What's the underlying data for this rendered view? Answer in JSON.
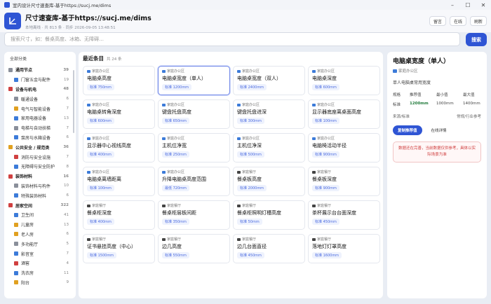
{
  "window": {
    "title": "室内设计尺寸速查库-基于https://sucj.me/dims"
  },
  "header": {
    "title": "尺寸速查库-基于https://sucj.me/dims",
    "subtitle": "本地离线 · 共 813 条 · 同步 2026-09-05 13:48:51",
    "buttons": [
      "留言",
      "在线",
      "刷新"
    ]
  },
  "search": {
    "placeholder": "搜索尺寸，如：餐桌高度、冰箱、无障碍…",
    "button": "搜索"
  },
  "sidebar": {
    "header": "全部分类",
    "items": [
      {
        "label": "通用节点",
        "count": "39",
        "level": "section",
        "color": "#8a8f9a"
      },
      {
        "label": "门窗五金与配件",
        "count": "19",
        "level": "sub",
        "color": "#3c7bd9"
      },
      {
        "label": "设备与机电",
        "count": "48",
        "level": "section",
        "color": "#d04040"
      },
      {
        "label": "暖通设备",
        "count": "6",
        "level": "sub",
        "color": "#8a8f9a"
      },
      {
        "label": "电气与智能设备",
        "count": "7",
        "level": "sub",
        "color": "#e0a020"
      },
      {
        "label": "家用电器设备",
        "count": "13",
        "level": "sub",
        "color": "#3c7bd9"
      },
      {
        "label": "电梯与自动扶梯",
        "count": "7",
        "level": "sub",
        "color": "#8a8f9a"
      },
      {
        "label": "泵房与水箱设备",
        "count": "6",
        "level": "sub",
        "color": "#3c7bd9"
      },
      {
        "label": "公共安全 / 规范类",
        "count": "36",
        "level": "section",
        "color": "#e0a020"
      },
      {
        "label": "消防与安全设施",
        "count": "7",
        "level": "sub",
        "color": "#d04040"
      },
      {
        "label": "无障碍与安全防护",
        "count": "8",
        "level": "sub",
        "color": "#3c7bd9"
      },
      {
        "label": "装饰材料",
        "count": "16",
        "level": "section",
        "color": "#d04040"
      },
      {
        "label": "装饰材料与构件",
        "count": "10",
        "level": "sub",
        "color": "#8a8f9a"
      },
      {
        "label": "特殊装饰材料",
        "count": "6",
        "level": "sub",
        "color": "#3c7bd9"
      },
      {
        "label": "居家空间",
        "count": "322",
        "level": "section",
        "color": "#d04040"
      },
      {
        "label": "卫生间",
        "count": "41",
        "level": "sub",
        "color": "#3c7bd9"
      },
      {
        "label": "儿童房",
        "count": "13",
        "level": "sub",
        "color": "#e0a020"
      },
      {
        "label": "老人房",
        "count": "6",
        "level": "sub",
        "color": "#e0a020"
      },
      {
        "label": "多功能厅",
        "count": "5",
        "level": "sub",
        "color": "#8a8f9a"
      },
      {
        "label": "影音室",
        "count": "7",
        "level": "sub",
        "color": "#3c7bd9"
      },
      {
        "label": "酒窖",
        "count": "4",
        "level": "sub",
        "color": "#d04040"
      },
      {
        "label": "洗衣房",
        "count": "11",
        "level": "sub",
        "color": "#3c7bd9"
      },
      {
        "label": "阳台",
        "count": "9",
        "level": "sub",
        "color": "#e0a020"
      }
    ]
  },
  "main": {
    "title": "最近条目",
    "count": "共 24 条",
    "cards": [
      {
        "category": "家庭办公区",
        "name": "电脑桌高度",
        "tag": "标准 750mm",
        "color": "#3c7bd9"
      },
      {
        "category": "家庭办公区",
        "name": "电脑桌宽度（单人）",
        "tag": "标准 1200mm",
        "color": "#3c7bd9",
        "selected": true
      },
      {
        "category": "家庭办公区",
        "name": "电脑桌宽度（双人）",
        "tag": "标准 2400mm",
        "color": "#3c7bd9"
      },
      {
        "category": "家庭办公区",
        "name": "电脑桌深度",
        "tag": "标准 600mm",
        "color": "#3c7bd9"
      },
      {
        "category": "家庭办公区",
        "name": "电脑桌转角深度",
        "tag": "标准 600mm",
        "color": "#3c7bd9"
      },
      {
        "category": "家庭办公区",
        "name": "键盘托盘高度",
        "tag": "标准 650mm",
        "color": "#3c7bd9"
      },
      {
        "category": "家庭办公区",
        "name": "键盘托盘进深",
        "tag": "标准 300mm",
        "color": "#3c7bd9"
      },
      {
        "category": "家庭办公区",
        "name": "显示器底座离桌面高度",
        "tag": "标准 100mm",
        "color": "#3c7bd9"
      },
      {
        "category": "家庭办公区",
        "name": "显示器中心视线高度",
        "tag": "标准 400mm",
        "color": "#3c7bd9"
      },
      {
        "category": "家庭办公区",
        "name": "主机位净宽",
        "tag": "标准 250mm",
        "color": "#3c7bd9"
      },
      {
        "category": "家庭办公区",
        "name": "主机位净深",
        "tag": "标准 500mm",
        "color": "#3c7bd9"
      },
      {
        "category": "家庭办公区",
        "name": "电脑椅活动半径",
        "tag": "标准 900mm",
        "color": "#3c7bd9"
      },
      {
        "category": "家庭办公区",
        "name": "电脑桌离墙距离",
        "tag": "标准 100mm",
        "color": "#3c7bd9"
      },
      {
        "category": "家庭办公区",
        "name": "升降电脑桌高度范围",
        "tag": "最低 720mm",
        "color": "#3c7bd9"
      },
      {
        "category": "家庭餐厅",
        "name": "餐桌板高度",
        "tag": "标准 2000mm",
        "color": "#444444"
      },
      {
        "category": "家庭餐厅",
        "name": "餐桌板深度",
        "tag": "标准 900mm",
        "color": "#444444"
      },
      {
        "category": "家庭餐厅",
        "name": "餐桌柜深度",
        "tag": "标准 400mm",
        "color": "#444444"
      },
      {
        "category": "家庭餐厅",
        "name": "餐桌柜层板间距",
        "tag": "标准 350mm",
        "color": "#444444"
      },
      {
        "category": "家庭餐厅",
        "name": "餐桌柜照明灯槽高度",
        "tag": "标准 50mm",
        "color": "#444444"
      },
      {
        "category": "家庭餐厅",
        "name": "茶杯展示台台面深度",
        "tag": "标准 450mm",
        "color": "#444444"
      },
      {
        "category": "家庭餐厅",
        "name": "证书悬挂高度（中心）",
        "tag": "标准 1500mm",
        "color": "#444444"
      },
      {
        "category": "家庭餐厅",
        "name": "边几高度",
        "tag": "标准 550mm",
        "color": "#444444"
      },
      {
        "category": "家庭餐厅",
        "name": "边几台面直径",
        "tag": "标准 450mm",
        "color": "#444444"
      },
      {
        "category": "家庭餐厅",
        "name": "落地灯灯罩高度",
        "tag": "标准 1600mm",
        "color": "#444444"
      }
    ]
  },
  "detail": {
    "title": "电脑桌宽度（单人）",
    "category": "家庭办公区",
    "description": "单人电脑桌常用宽度",
    "table_headers": [
      "规格",
      "推荐值",
      "最小值",
      "最大值"
    ],
    "table_values": [
      "标准",
      "1200mm",
      "1000mm",
      "1400mm"
    ],
    "source_label": "来源/标准",
    "source_value": "常规/行业参考",
    "copy_button": "复制推荐值",
    "online_button": "在线详情",
    "warning": "数据还在完善，当前数据仅供参考，具体以实际场景为准"
  }
}
